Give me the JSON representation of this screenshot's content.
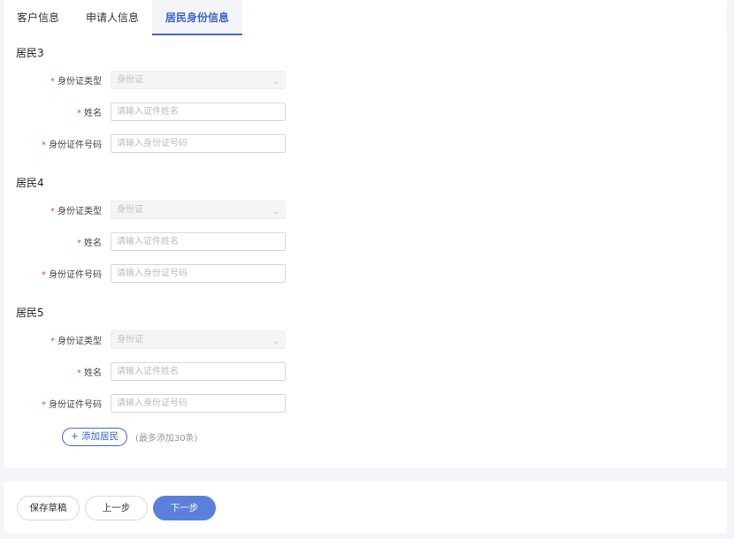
{
  "tabs": [
    {
      "label": "客户信息"
    },
    {
      "label": "申请人信息"
    },
    {
      "label": "居民身份信息",
      "active": true
    }
  ],
  "residents": [
    {
      "title": "居民3",
      "id_type_label": "身份证类型",
      "id_type_value": "身份证",
      "name_label": "姓名",
      "name_placeholder": "请输入证件姓名",
      "id_no_label": "身份证件号码",
      "id_no_placeholder": "请输入身份证号码"
    },
    {
      "title": "居民4",
      "id_type_label": "身份证类型",
      "id_type_value": "身份证",
      "name_label": "姓名",
      "name_placeholder": "请输入证件姓名",
      "id_no_label": "身份证件号码",
      "id_no_placeholder": "请输入身份证号码"
    },
    {
      "title": "居民5",
      "id_type_label": "身份证类型",
      "id_type_value": "身份证",
      "name_label": "姓名",
      "name_placeholder": "请输入证件姓名",
      "id_no_label": "身份证件号码",
      "id_no_placeholder": "请输入身份证号码"
    }
  ],
  "required_mark": "*",
  "add_button": "+ 添加居民",
  "add_note": "(最多添加30条)",
  "footer": {
    "save_draft": "保存草稿",
    "prev": "上一步",
    "next": "下一步"
  },
  "colors": {
    "accent": "#3b62d1",
    "primary_button": "#5b80dc",
    "required": "#e5484d"
  }
}
